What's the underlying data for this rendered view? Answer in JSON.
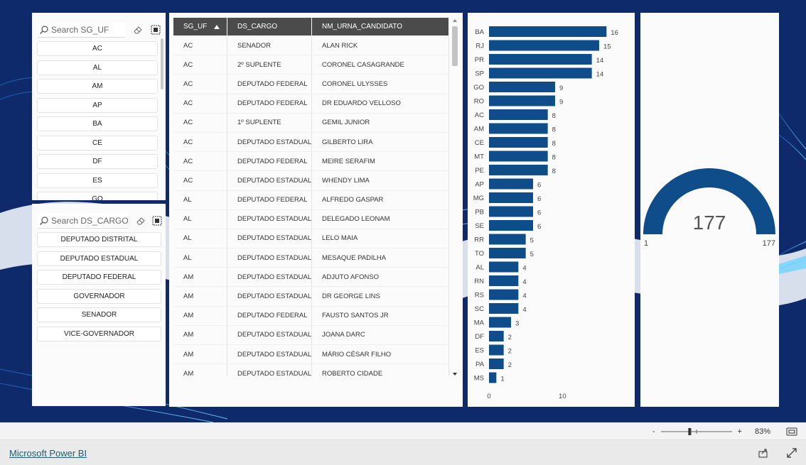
{
  "slicer_uf": {
    "placeholder": "Search SG_UF",
    "items": [
      "AC",
      "AL",
      "AM",
      "AP",
      "BA",
      "CE",
      "DF",
      "ES",
      "GO"
    ]
  },
  "slicer_cargo": {
    "placeholder": "Search DS_CARGO",
    "items": [
      "DEPUTADO DISTRITAL",
      "DEPUTADO ESTADUAL",
      "DEPUTADO FEDERAL",
      "GOVERNADOR",
      "SENADOR",
      "VICE-GOVERNADOR"
    ]
  },
  "table": {
    "headers": [
      "SG_UF",
      "DS_CARGO",
      "NM_URNA_CANDIDATO"
    ],
    "sort_column": "SG_UF",
    "sort_direction": "ascending",
    "rows": [
      [
        "AC",
        "SENADOR",
        "ALAN RICK"
      ],
      [
        "AC",
        "2º SUPLENTE",
        "CORONEL CASAGRANDE"
      ],
      [
        "AC",
        "DEPUTADO FEDERAL",
        "CORONEL ULYSSES"
      ],
      [
        "AC",
        "DEPUTADO FEDERAL",
        "DR EDUARDO VELLOSO"
      ],
      [
        "AC",
        "1º SUPLENTE",
        "GEMIL JUNIOR"
      ],
      [
        "AC",
        "DEPUTADO ESTADUAL",
        "GILBERTO LIRA"
      ],
      [
        "AC",
        "DEPUTADO FEDERAL",
        "MEIRE SERAFIM"
      ],
      [
        "AC",
        "DEPUTADO ESTADUAL",
        "WHENDY LIMA"
      ],
      [
        "AL",
        "DEPUTADO FEDERAL",
        "ALFREDO GASPAR"
      ],
      [
        "AL",
        "DEPUTADO ESTADUAL",
        "DELEGADO LEONAM"
      ],
      [
        "AL",
        "DEPUTADO ESTADUAL",
        "LELO MAIA"
      ],
      [
        "AL",
        "DEPUTADO ESTADUAL",
        "MESAQUE PADILHA"
      ],
      [
        "AM",
        "DEPUTADO ESTADUAL",
        "ADJUTO AFONSO"
      ],
      [
        "AM",
        "DEPUTADO ESTADUAL",
        "DR GEORGE LINS"
      ],
      [
        "AM",
        "DEPUTADO FEDERAL",
        "FAUSTO SANTOS JR"
      ],
      [
        "AM",
        "DEPUTADO ESTADUAL",
        "JOANA DARC"
      ],
      [
        "AM",
        "DEPUTADO ESTADUAL",
        "MÁRIO CÉSAR FILHO"
      ],
      [
        "AM",
        "DEPUTADO ESTADUAL",
        "ROBERTO CIDADE"
      ]
    ]
  },
  "chart_data": {
    "type": "bar",
    "orientation": "horizontal",
    "categories": [
      "BA",
      "RJ",
      "PR",
      "SP",
      "GO",
      "RO",
      "AC",
      "AM",
      "CE",
      "MT",
      "PE",
      "AP",
      "MG",
      "PB",
      "SE",
      "RR",
      "TO",
      "AL",
      "RN",
      "RS",
      "SC",
      "MA",
      "DF",
      "ES",
      "PA",
      "MS"
    ],
    "values": [
      16,
      15,
      14,
      14,
      9,
      9,
      8,
      8,
      8,
      8,
      8,
      6,
      6,
      6,
      6,
      5,
      5,
      4,
      4,
      4,
      4,
      3,
      2,
      2,
      2,
      1
    ],
    "xticks": [
      "0",
      "10"
    ],
    "xlim": [
      0,
      18
    ],
    "bar_color": "#0f4c8a",
    "grid": false
  },
  "gauge": {
    "value": "177",
    "min": "1",
    "max": "177",
    "fill_fraction": 1.0,
    "color": "#0f4c8a"
  },
  "footer": {
    "zoom_minus": "-",
    "zoom_plus": "+",
    "zoom_level": "83%",
    "zoom_fraction": 0.4,
    "brand_link": "Microsoft Power BI"
  },
  "colors": {
    "canvas_bg": "#0f2a6b",
    "header_bg": "#4b4b4b",
    "accent": "#0f4c8a"
  }
}
